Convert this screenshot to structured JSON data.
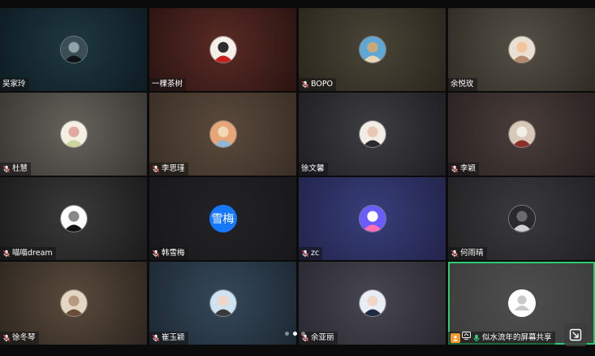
{
  "participants": [
    {
      "name": "吴家玲",
      "muted": false,
      "bg": [
        "#1f3842",
        "#0e1b22"
      ],
      "avatar": {
        "type": "photo",
        "colors": [
          "#3b4d55",
          "#0c1418",
          "#8fa3aa"
        ]
      }
    },
    {
      "name": "一棵茶树",
      "muted": false,
      "bg": [
        "#5a2a24",
        "#2a1412"
      ],
      "avatar": {
        "type": "photo",
        "colors": [
          "#f4efe9",
          "#c81e1e",
          "#2d2d2d"
        ]
      }
    },
    {
      "name": "BOPO",
      "muted": true,
      "bg": [
        "#4a4538",
        "#2a261d"
      ],
      "avatar": {
        "type": "photo",
        "colors": [
          "#5fa8d6",
          "#e8d5b3",
          "#c9a778"
        ]
      }
    },
    {
      "name": "余悦玫",
      "muted": false,
      "bg": [
        "#555046",
        "#302c25"
      ],
      "avatar": {
        "type": "photo",
        "colors": [
          "#e9dfd2",
          "#b48a6c",
          "#f2c59a"
        ]
      }
    },
    {
      "name": "杜慧",
      "muted": true,
      "bg": [
        "#66625c",
        "#3a3733"
      ],
      "avatar": {
        "type": "photo",
        "colors": [
          "#f3efe3",
          "#c9d59a",
          "#e2a9a1"
        ]
      }
    },
    {
      "name": "李思瑾",
      "muted": true,
      "bg": [
        "#5a4a3c",
        "#3a2e25"
      ],
      "avatar": {
        "type": "photo",
        "colors": [
          "#e8a577",
          "#8fb6d8",
          "#f1d9b8"
        ]
      }
    },
    {
      "name": "徐文馨",
      "muted": false,
      "bg": [
        "#3d3d42",
        "#1f1f23"
      ],
      "avatar": {
        "type": "photo",
        "colors": [
          "#f1ece4",
          "#2b2b2b",
          "#e8c8b4"
        ]
      }
    },
    {
      "name": "李颖",
      "muted": true,
      "bg": [
        "#4a3e3b",
        "#2a2221"
      ],
      "avatar": {
        "type": "photo",
        "colors": [
          "#d8c8b8",
          "#8a2f2a",
          "#f2eee8"
        ]
      }
    },
    {
      "name": "喵喵dream",
      "muted": true,
      "bg": [
        "#3a3a3a",
        "#1b1b1b"
      ],
      "avatar": {
        "type": "photo",
        "colors": [
          "#ffffff",
          "#111111",
          "#888888"
        ]
      }
    },
    {
      "name": "韩雪梅",
      "muted": true,
      "bg": [
        "#232326",
        "#18181a"
      ],
      "avatar": {
        "type": "text",
        "text": "雪梅",
        "color": "#1677ff"
      }
    },
    {
      "name": "zc",
      "muted": true,
      "bg": [
        "#383e7a",
        "#22244a"
      ],
      "avatar": {
        "type": "photo",
        "colors": [
          "#6a5cff",
          "#ff6fb1",
          "#ffffff"
        ]
      }
    },
    {
      "name": "何雨晴",
      "muted": true,
      "bg": [
        "#3a3a3d",
        "#222225"
      ],
      "avatar": {
        "type": "photo",
        "colors": [
          "#2a2a2e",
          "#cfcfcf",
          "#6b6b6b"
        ]
      }
    },
    {
      "name": "徐冬琴",
      "muted": true,
      "bg": [
        "#5a4b3c",
        "#2e2620"
      ],
      "avatar": {
        "type": "photo",
        "colors": [
          "#e4d6c4",
          "#6b4e37",
          "#b59a80"
        ]
      }
    },
    {
      "name": "崔玉颖",
      "muted": true,
      "bg": [
        "#35495a",
        "#1d2833"
      ],
      "avatar": {
        "type": "photo",
        "colors": [
          "#cfe2f0",
          "#3a3a3a",
          "#f1d6c7"
        ]
      }
    },
    {
      "name": "余亚丽",
      "muted": true,
      "bg": [
        "#484650",
        "#2a2930"
      ],
      "avatar": {
        "type": "photo",
        "colors": [
          "#e8eef5",
          "#1f2a44",
          "#f0d7c6"
        ]
      }
    },
    {
      "name": "似水流年的屏幕共享",
      "muted": false,
      "sharing": true,
      "bg": [
        "#4e4e4e",
        "#3c3c3c"
      ],
      "avatar": {
        "type": "default",
        "colors": [
          "#ffffff",
          "#c9c9c9"
        ]
      }
    }
  ],
  "pager": {
    "pages": 3,
    "current": 1
  },
  "colors": {
    "active_border": "#2ecc71",
    "mic_red": "#e54545",
    "mic_green": "#3ddc84",
    "share_orange": "#f29a2e"
  },
  "icons": {
    "expand": "expand-icon",
    "mic": "mic-icon",
    "screen_share": "screen-share-icon"
  }
}
